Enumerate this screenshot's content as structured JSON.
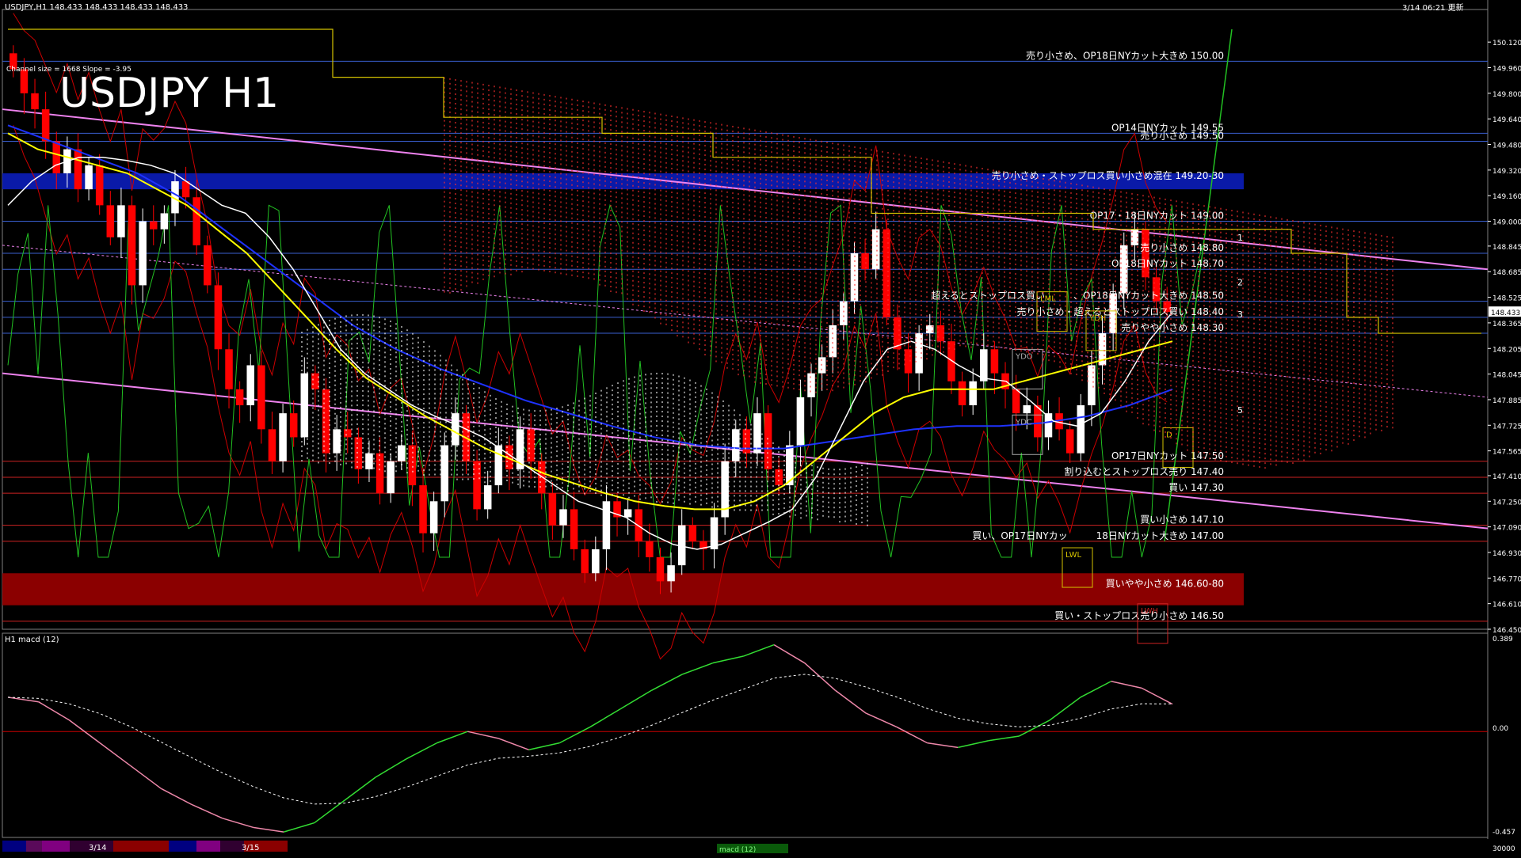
{
  "header": {
    "symbol_line": "USDJPY,H1  148.433 148.433 148.433 148.433",
    "big_title": "USDJPY H1",
    "channel_info": "Channel size = 1668 Slope = -3.95",
    "timestamp": "3/14 06:21 更新"
  },
  "macd_panel": {
    "label": "H1 macd (12)",
    "scale_top": "0.389",
    "scale_zero": "0.00",
    "scale_bottom": "-0.457",
    "volume_label": "30000"
  },
  "bottom_bar": {
    "date_labels": [
      "3/14",
      "3/15"
    ],
    "indicator_label": "macd (12)"
  },
  "colors": {
    "background": "#000000",
    "bull_candle": "#ffffff",
    "bear_candle": "#ff0000",
    "resistance_band": "#0a1aa8",
    "support_band": "#8b0000",
    "channel_line": "#ee82ee",
    "ma_white": "#ffffff",
    "ma_yellow": "#ffff00",
    "ma_blue": "#1e32ff",
    "rsi_green": "#22c022",
    "bollinger_red": "#cc0000",
    "macd_green": "#33dd33",
    "macd_pink": "#ee88aa",
    "level_line_blue": "#3a5fd0",
    "level_line_red": "#cc2222"
  },
  "chart_data": {
    "type": "line",
    "title": "USDJPY H1",
    "ylim": [
      146.45,
      150.2
    ],
    "y_ticks": [
      "150.120",
      "149.960",
      "149.800",
      "149.640",
      "149.480",
      "149.320",
      "149.160",
      "149.000",
      "148.845",
      "148.685",
      "148.525",
      "148.365",
      "148.205",
      "148.045",
      "147.885",
      "147.725",
      "147.565",
      "147.410",
      "147.250",
      "147.090",
      "146.930",
      "146.770",
      "146.610",
      "146.450"
    ],
    "current_price": "148.433",
    "level_annotations": [
      {
        "text": "売り小さめ、OP18日NYカット大きめ 150.00",
        "price": 150.0,
        "kind": "blue"
      },
      {
        "text": "OP14日NYカット 149.55",
        "price": 149.55,
        "kind": "blue"
      },
      {
        "text": "売り小さめ 149.50",
        "price": 149.5,
        "kind": "blue"
      },
      {
        "text": "売り小さめ・ストップロス買い小さめ混在 149.20-30",
        "price": 149.25,
        "kind": "band-blue"
      },
      {
        "text": "OP17・18日NYカット 149.00",
        "price": 149.0,
        "kind": "blue"
      },
      {
        "text": "売り小さめ 148.80",
        "price": 148.8,
        "kind": "blue"
      },
      {
        "text": "OP18日NYカット 148.70",
        "price": 148.7,
        "kind": "blue"
      },
      {
        "text": "超えるとストップロス買い　　　、OP18日NYカット大きめ 148.50",
        "price": 148.5,
        "kind": "blue"
      },
      {
        "text": "売り小さめ・超えるとストップロス買い 148.40",
        "price": 148.4,
        "kind": "blue"
      },
      {
        "text": "売りやや小さめ 148.30",
        "price": 148.3,
        "kind": "blue"
      },
      {
        "text": "OP17日NYカット 147.50",
        "price": 147.5,
        "kind": "red"
      },
      {
        "text": "割り込むとストップロス売り 147.40",
        "price": 147.4,
        "kind": "red"
      },
      {
        "text": "買い 147.30",
        "price": 147.3,
        "kind": "red"
      },
      {
        "text": "買い小さめ 147.10",
        "price": 147.1,
        "kind": "red"
      },
      {
        "text": "買い、OP17日NYカッ　　　18日NYカット大きめ 147.00",
        "price": 147.0,
        "kind": "red"
      },
      {
        "text": "買いやや小さめ 146.60-80",
        "price": 146.7,
        "kind": "band-red"
      },
      {
        "text": "買い・ストップロス売り小さめ 146.50",
        "price": 146.5,
        "kind": "red"
      }
    ],
    "wave_labels": [
      "1",
      "2",
      "3",
      "5"
    ],
    "box_labels": [
      "YDO",
      "YDC",
      "LML",
      "YDH",
      "D",
      "LWL",
      "LWH"
    ],
    "close": [
      149.95,
      149.8,
      149.7,
      149.5,
      149.3,
      149.45,
      149.2,
      149.35,
      149.1,
      148.9,
      149.1,
      148.6,
      149.0,
      148.95,
      149.05,
      149.25,
      149.15,
      148.85,
      148.6,
      148.2,
      147.95,
      147.85,
      148.1,
      147.7,
      147.5,
      147.8,
      147.65,
      148.05,
      147.95,
      147.55,
      147.7,
      147.65,
      147.45,
      147.55,
      147.3,
      147.5,
      147.6,
      147.35,
      147.05,
      147.25,
      147.6,
      147.8,
      147.5,
      147.2,
      147.35,
      147.6,
      147.45,
      147.7,
      147.5,
      147.3,
      147.1,
      147.2,
      146.95,
      146.8,
      146.95,
      147.25,
      147.15,
      147.2,
      147.0,
      146.9,
      146.75,
      146.85,
      147.1,
      147.0,
      146.95,
      147.15,
      147.5,
      147.7,
      147.55,
      147.8,
      147.45,
      147.35,
      147.6,
      147.9,
      148.05,
      148.15,
      148.35,
      148.5,
      148.8,
      148.7,
      148.95,
      148.4,
      148.2,
      148.05,
      148.3,
      148.35,
      148.25,
      148.0,
      147.85,
      148.0,
      148.2,
      148.05,
      147.95,
      147.8,
      147.85,
      147.65,
      147.8,
      147.7,
      147.55,
      147.85,
      148.1,
      148.3,
      148.55,
      148.85,
      148.95,
      148.65,
      148.5,
      148.433
    ],
    "ma_white": [
      149.1,
      149.25,
      149.35,
      149.4,
      149.4,
      149.38,
      149.35,
      149.3,
      149.2,
      149.1,
      149.05,
      148.9,
      148.7,
      148.45,
      148.2,
      148.05,
      147.95,
      147.85,
      147.78,
      147.72,
      147.65,
      147.55,
      147.45,
      147.35,
      147.25,
      147.2,
      147.15,
      147.05,
      146.98,
      146.95,
      146.98,
      147.05,
      147.12,
      147.2,
      147.4,
      147.7,
      148.0,
      148.2,
      148.25,
      148.2,
      148.1,
      148.02,
      148.0,
      147.88,
      147.75,
      147.72,
      147.8,
      148.0,
      148.25,
      148.433
    ],
    "ma_yellow": [
      149.55,
      149.45,
      149.4,
      149.35,
      149.3,
      149.2,
      149.1,
      148.95,
      148.8,
      148.6,
      148.4,
      148.2,
      148.02,
      147.9,
      147.78,
      147.68,
      147.58,
      147.5,
      147.42,
      147.36,
      147.3,
      147.25,
      147.22,
      147.2,
      147.2,
      147.25,
      147.35,
      147.5,
      147.65,
      147.8,
      147.9,
      147.95,
      147.95,
      147.95,
      148.0,
      148.05,
      148.1,
      148.15,
      148.2,
      148.25
    ],
    "ma_blue": [
      149.6,
      149.5,
      149.4,
      149.3,
      149.15,
      148.95,
      148.75,
      148.55,
      148.35,
      148.2,
      148.08,
      147.98,
      147.88,
      147.8,
      147.72,
      147.65,
      147.6,
      147.58,
      147.58,
      147.62,
      147.66,
      147.7,
      147.72,
      147.72,
      147.74,
      147.78,
      147.85,
      147.95
    ],
    "macd_ylim": [
      -0.457,
      0.389
    ],
    "macd_main": [
      0.15,
      0.13,
      0.05,
      -0.05,
      -0.15,
      -0.25,
      -0.32,
      -0.38,
      -0.42,
      -0.44,
      -0.4,
      -0.3,
      -0.2,
      -0.12,
      -0.05,
      0.0,
      -0.03,
      -0.08,
      -0.05,
      0.02,
      0.1,
      0.18,
      0.25,
      0.3,
      0.33,
      0.38,
      0.3,
      0.18,
      0.08,
      0.02,
      -0.05,
      -0.07,
      -0.04,
      -0.02,
      0.05,
      0.15,
      0.22,
      0.19,
      0.12
    ]
  }
}
